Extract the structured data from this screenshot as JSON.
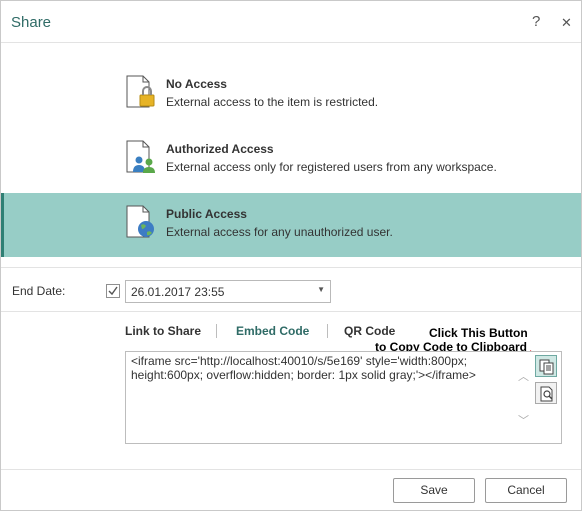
{
  "dialog": {
    "title": "Share",
    "help_label": "?",
    "close_label": "✕"
  },
  "options": [
    {
      "title": "No Access",
      "desc": "External access to the item is restricted."
    },
    {
      "title": "Authorized Access",
      "desc": "External access only for registered users from any workspace."
    },
    {
      "title": "Public Access",
      "desc": "External access for any unauthorized user."
    }
  ],
  "selected_option": "Public Access",
  "end_date": {
    "label": "End Date:",
    "checked": true,
    "value": "26.01.2017 23:55"
  },
  "tabs": {
    "link": "Link to Share",
    "embed": "Embed Code",
    "qr": "QR Code",
    "active": "Embed Code"
  },
  "embed_code": "<iframe src='http://localhost:40010/s/5e169' style='width:800px; height:600px; overflow:hidden; border: 1px solid gray;'></iframe>",
  "annotation": {
    "line1": "Click This Button",
    "line2": "to Copy Code to Clipboard"
  },
  "footer": {
    "save": "Save",
    "cancel": "Cancel"
  },
  "colors": {
    "accent": "#2f6b66",
    "selected_bg": "#97cdc6",
    "annotation_arrow": "#e0101a"
  }
}
